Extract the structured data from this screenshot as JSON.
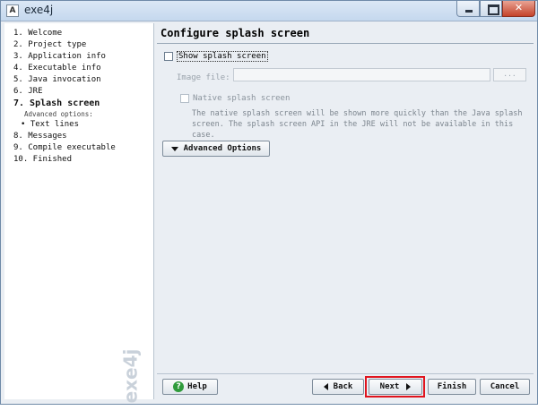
{
  "window": {
    "title": "exe4j",
    "icon_glyph": "A",
    "close_glyph": "✕",
    "accent_close": "#c4432b"
  },
  "sidebar": {
    "steps": [
      {
        "label": "1. Welcome"
      },
      {
        "label": "2. Project type"
      },
      {
        "label": "3. Application info"
      },
      {
        "label": "4. Executable info"
      },
      {
        "label": "5. Java invocation"
      },
      {
        "label": "6. JRE"
      },
      {
        "label": "7. Splash screen"
      },
      {
        "label": "Advanced options:"
      },
      {
        "label": "• Text lines"
      },
      {
        "label": "8. Messages"
      },
      {
        "label": "9. Compile executable"
      },
      {
        "label": "10. Finished"
      }
    ],
    "current_index": 6,
    "watermark": "exe4j"
  },
  "main": {
    "title": "Configure splash screen",
    "show_splash_label": "Show splash screen",
    "image_file_label": "Image file:",
    "image_file_value": "",
    "browse_label": "...",
    "native_label": "Native splash screen",
    "description": "The native splash screen will be shown more quickly than the Java splash screen. The splash screen API in the JRE will not be available in this case.",
    "advanced_label": "Advanced Options"
  },
  "footer": {
    "help_label": "Help",
    "help_icon_glyph": "?",
    "back_label": "Back",
    "next_label": "Next",
    "finish_label": "Finish",
    "cancel_label": "Cancel",
    "highlight_color": "#e0141e"
  }
}
